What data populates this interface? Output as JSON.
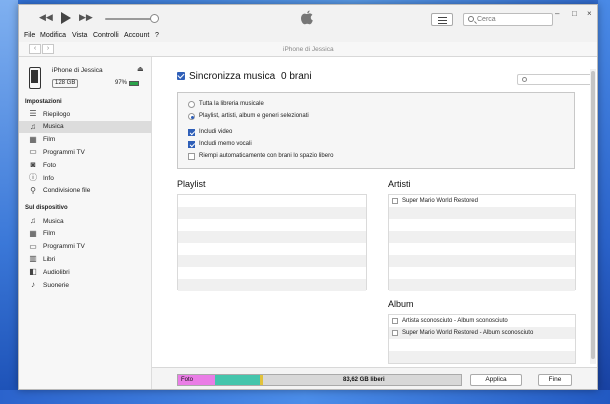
{
  "window": {
    "search_placeholder": "Cerca",
    "nav_title": "iPhone di Jessica",
    "controls": {
      "minimize": "–",
      "maximize": "□",
      "close": "×"
    }
  },
  "menubar": [
    "File",
    "Modifica",
    "Vista",
    "Controlli",
    "Account",
    "?"
  ],
  "device": {
    "name": "iPhone di Jessica",
    "capacity": "128 GB",
    "battery": "97%"
  },
  "sidebar": {
    "settings_header": "Impostazioni",
    "settings_items": [
      {
        "label": "Riepilogo",
        "icon": "summary-icon"
      },
      {
        "label": "Musica",
        "icon": "music-icon"
      },
      {
        "label": "Film",
        "icon": "film-icon"
      },
      {
        "label": "Programmi TV",
        "icon": "tv-icon"
      },
      {
        "label": "Foto",
        "icon": "camera-icon"
      },
      {
        "label": "Info",
        "icon": "info-icon"
      },
      {
        "label": "Condivisione file",
        "icon": "share-icon"
      }
    ],
    "device_header": "Sul dispositivo",
    "device_items": [
      {
        "label": "Musica",
        "icon": "music-icon"
      },
      {
        "label": "Film",
        "icon": "film-icon"
      },
      {
        "label": "Programmi TV",
        "icon": "tv-icon"
      },
      {
        "label": "Libri",
        "icon": "book-icon"
      },
      {
        "label": "Audiolibri",
        "icon": "audiobook-icon"
      },
      {
        "label": "Suonerie",
        "icon": "bell-icon"
      }
    ],
    "active_item": "Musica"
  },
  "sync": {
    "title": "Sincronizza musica",
    "count": "0 brani",
    "checked": true,
    "options": [
      {
        "type": "radio",
        "label": "Tutta la libreria musicale",
        "checked": false
      },
      {
        "type": "radio",
        "label": "Playlist, artisti, album e generi selezionati",
        "checked": true
      },
      {
        "type": "checkbox",
        "label": "Includi video",
        "checked": true
      },
      {
        "type": "checkbox",
        "label": "Includi memo vocali",
        "checked": true
      },
      {
        "type": "checkbox",
        "label": "Riempi automaticamente con brani lo spazio libero",
        "checked": false
      }
    ]
  },
  "playlist": {
    "title": "Playlist",
    "items": []
  },
  "artists": {
    "title": "Artisti",
    "items": [
      "Super Mario World Restored"
    ]
  },
  "albums": {
    "title": "Album",
    "items": [
      "Artista sconosciuto - Album sconosciuto",
      "Super Mario World Restored - Album sconosciuto"
    ]
  },
  "storage": {
    "label": "Foto",
    "free_label": "83,62 GB liberi",
    "segments": [
      {
        "name": "Foto",
        "fraction": 0.13,
        "color": "#ea7de6"
      },
      {
        "name": "Altro",
        "fraction": 0.16,
        "color": "#45c5ac"
      },
      {
        "name": "Altro2",
        "fraction": 0.01,
        "color": "#e2c23a"
      }
    ]
  },
  "buttons": {
    "apply": "Applica",
    "done": "Fine"
  }
}
